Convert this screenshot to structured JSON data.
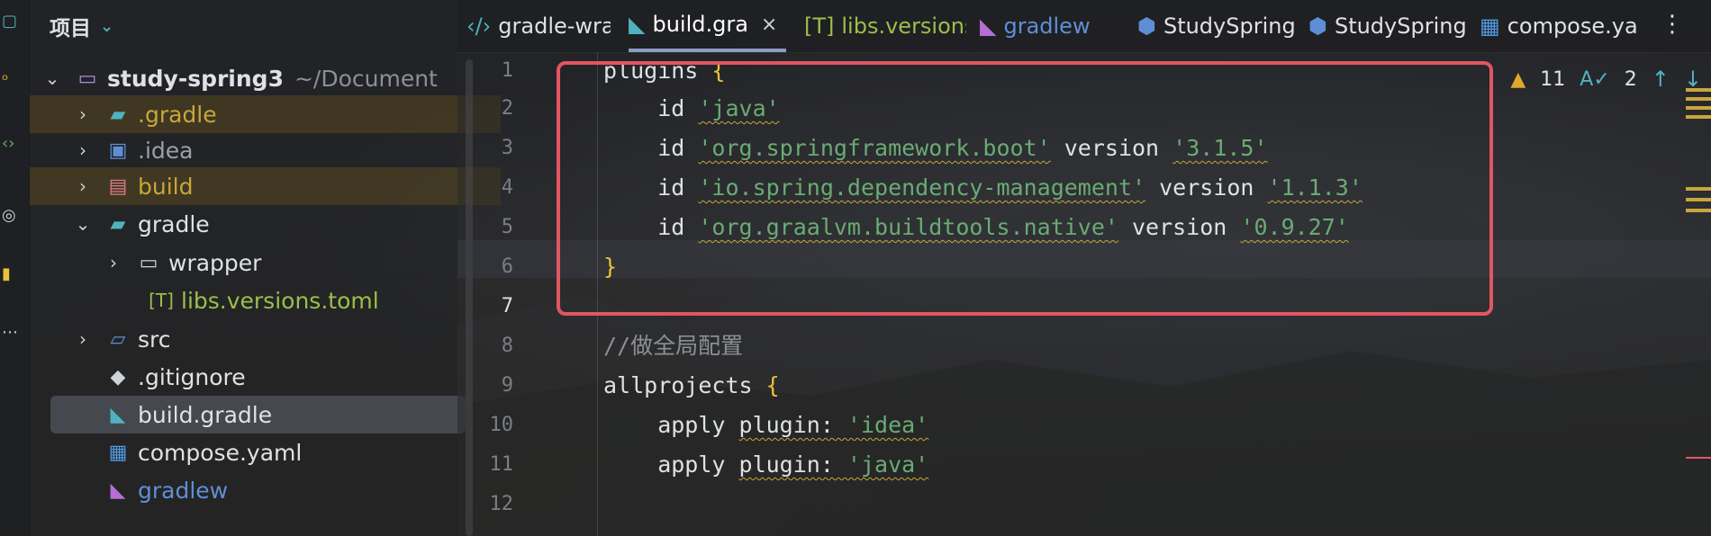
{
  "project_panel": {
    "title": "项目",
    "tree": [
      {
        "label": "study-spring3",
        "hint": "~/Document",
        "icon": "folder-icon"
      },
      {
        "label": ".gradle",
        "icon": "gradle-folder-icon"
      },
      {
        "label": ".idea",
        "icon": "idea-folder-icon"
      },
      {
        "label": "build",
        "icon": "build-folder-icon"
      },
      {
        "label": "gradle",
        "icon": "gradle-folder-icon"
      },
      {
        "label": "wrapper",
        "icon": "folder-icon"
      },
      {
        "label": "libs.versions.toml",
        "icon": "toml-file-icon"
      },
      {
        "label": "src",
        "icon": "source-folder-icon"
      },
      {
        "label": ".gitignore",
        "icon": "git-icon"
      },
      {
        "label": "build.gradle",
        "icon": "gradle-file-icon"
      },
      {
        "label": "compose.yaml",
        "icon": "docker-icon"
      },
      {
        "label": "gradlew",
        "icon": "gradle-file-icon"
      }
    ]
  },
  "tabs": [
    {
      "label": "gradle-wrap"
    },
    {
      "label": "build.gra",
      "close": "×"
    },
    {
      "label": "libs.versions"
    },
    {
      "label": "gradlew"
    },
    {
      "label": "StudySpring"
    },
    {
      "label": "StudySpring"
    },
    {
      "label": "compose.ya"
    }
  ],
  "inspections": {
    "warnings": "11",
    "typos": "2"
  },
  "line_numbers": [
    "1",
    "2",
    "3",
    "4",
    "5",
    "6",
    "7",
    "8",
    "9",
    "10",
    "11",
    "12"
  ],
  "code": {
    "l1": {
      "kw": "plugins ",
      "brace": "{"
    },
    "l2": {
      "kw": "    id ",
      "s": "'java'"
    },
    "l3": {
      "kw": "    id ",
      "s": "'org.springframework.boot'",
      "mid": " version ",
      "v": "'3.1.5'"
    },
    "l4": {
      "kw": "    id ",
      "s": "'io.spring.dependency-management'",
      "mid": " version ",
      "v": "'1.1.3'"
    },
    "l5": {
      "kw": "    id ",
      "s": "'org.graalvm.buildtools.native'",
      "mid": " version ",
      "v": "'0.9.27'"
    },
    "l6": {
      "brace": "}"
    },
    "l8": {
      "comment": "//做全局配置"
    },
    "l9": {
      "kw": "allprojects ",
      "brace": "{"
    },
    "l10": {
      "kw": "    apply ",
      "p": "plugin:",
      "s": " 'idea'"
    },
    "l11": {
      "kw": "    apply ",
      "p": "plugin:",
      "s": " 'java'"
    }
  },
  "colors": {
    "annotation_box": "#e25563",
    "string": "#6aab73",
    "brace": "#e9c23a"
  }
}
